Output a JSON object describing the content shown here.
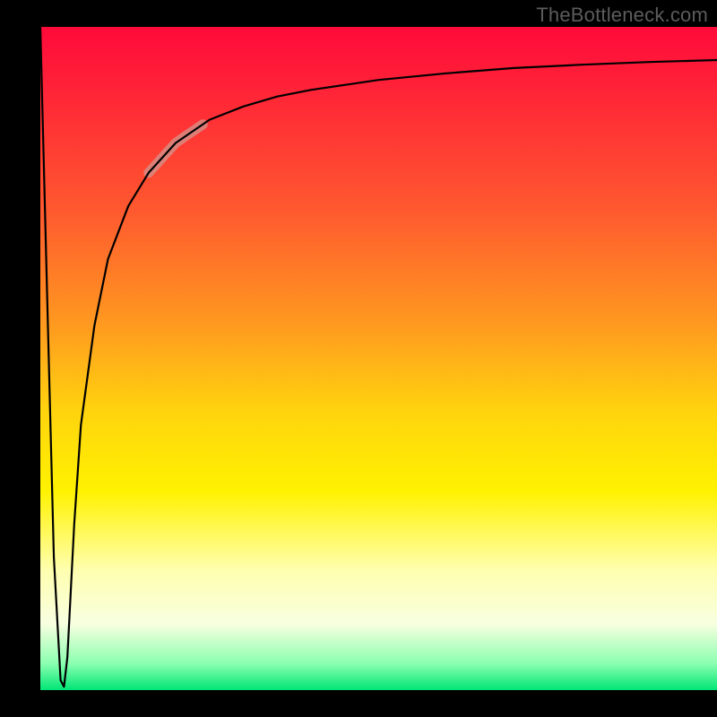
{
  "watermark": "TheBottleneck.com",
  "colors": {
    "background": "#000000",
    "gradient_top": "#ff0a3a",
    "gradient_mid1": "#ff9a1f",
    "gradient_mid2": "#fff200",
    "gradient_bottom": "#00e676",
    "curve": "#000000",
    "highlight": "#d58d86"
  },
  "chart_data": {
    "type": "line",
    "title": "",
    "xlabel": "",
    "ylabel": "",
    "xlim": [
      0,
      100
    ],
    "ylim": [
      0,
      100
    ],
    "grid": false,
    "legend": false,
    "annotations": [
      "TheBottleneck.com"
    ],
    "series": [
      {
        "name": "bottleneck-curve",
        "x": [
          0,
          1,
          2,
          3,
          3.5,
          4,
          5,
          6,
          8,
          10,
          13,
          16,
          20,
          25,
          30,
          35,
          40,
          50,
          60,
          70,
          80,
          90,
          100
        ],
        "y": [
          100,
          60,
          20,
          1.5,
          0.5,
          5,
          25,
          40,
          55,
          65,
          73,
          78,
          82.5,
          86,
          88,
          89.5,
          90.5,
          92,
          93,
          93.8,
          94.3,
          94.7,
          95
        ]
      }
    ],
    "highlight_segment": {
      "series": "bottleneck-curve",
      "x_start": 16,
      "x_end": 24,
      "note": "thick pale-red segment overlaid on curve near upper-left bend"
    }
  }
}
